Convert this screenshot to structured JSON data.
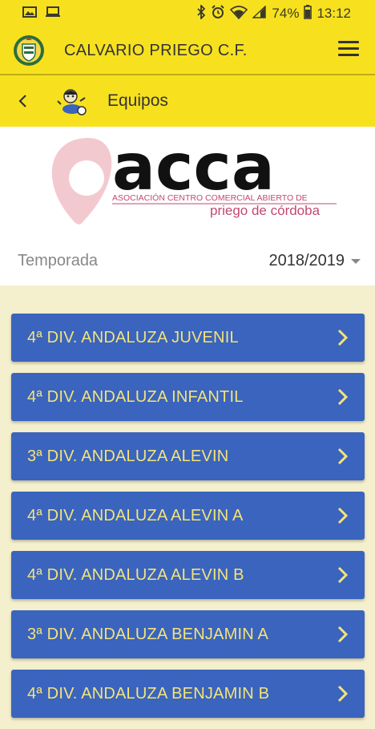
{
  "status": {
    "battery": "74%",
    "time": "13:12"
  },
  "header": {
    "title": "CALVARIO PRIEGO C.F."
  },
  "subheader": {
    "title": "Equipos"
  },
  "banner": {
    "logo_word": "acca",
    "line1": "ASOCIACIÓN CENTRO COMERCIAL ABIERTO DE",
    "line2": "priego de córdoba"
  },
  "season": {
    "label": "Temporada",
    "value": "2018/2019"
  },
  "teams": [
    {
      "label": "4ª DIV. ANDALUZA JUVENIL"
    },
    {
      "label": "4ª DIV. ANDALUZA INFANTIL"
    },
    {
      "label": "3ª DIV. ANDALUZA ALEVIN"
    },
    {
      "label": "4ª DIV. ANDALUZA ALEVIN A"
    },
    {
      "label": "4ª DIV. ANDALUZA ALEVIN B"
    },
    {
      "label": "3ª DIV. ANDALUZA BENJAMIN A"
    },
    {
      "label": "4ª DIV. ANDALUZA BENJAMIN B"
    }
  ],
  "colors": {
    "accent": "#f7e11f",
    "button": "#3a64bd",
    "button_text": "#f3e37a",
    "background": "#f4efcc"
  }
}
